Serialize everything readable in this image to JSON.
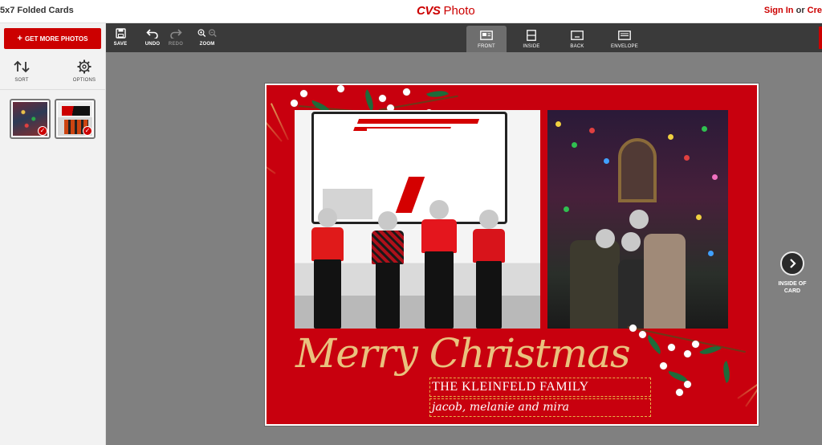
{
  "header": {
    "product_title": "5x7 Folded Cards",
    "brand_name": "CVS",
    "brand_suffix": "Photo",
    "sign_in": "Sign In",
    "or_text": "or",
    "create": "Cre"
  },
  "sidebar": {
    "get_photos_label": "GET MORE PHOTOS",
    "sort_label": "SORT",
    "options_label": "OPTIONS",
    "thumbnails": [
      {
        "selected": true
      },
      {
        "selected": true
      }
    ]
  },
  "toolbar": {
    "save": "SAVE",
    "undo": "UNDO",
    "redo": "REDO",
    "zoom": "ZOOM",
    "tabs": [
      {
        "label": "FRONT",
        "active": true
      },
      {
        "label": "INSIDE",
        "active": false
      },
      {
        "label": "BACK",
        "active": false
      },
      {
        "label": "ENVELOPE",
        "active": false
      }
    ]
  },
  "card": {
    "greeting": "Merry Christmas",
    "family_line": "THE KLEINFELD FAMILY",
    "names_line": "jacob, melanie and mira",
    "background_color": "#c8000e"
  },
  "navigation": {
    "next_label_line1": "INSIDE OF",
    "next_label_line2": "CARD"
  },
  "colors": {
    "accent": "#cc0000",
    "toolbar": "#3a3a3a",
    "workspace": "#808080",
    "gold": "#e9c27e"
  }
}
